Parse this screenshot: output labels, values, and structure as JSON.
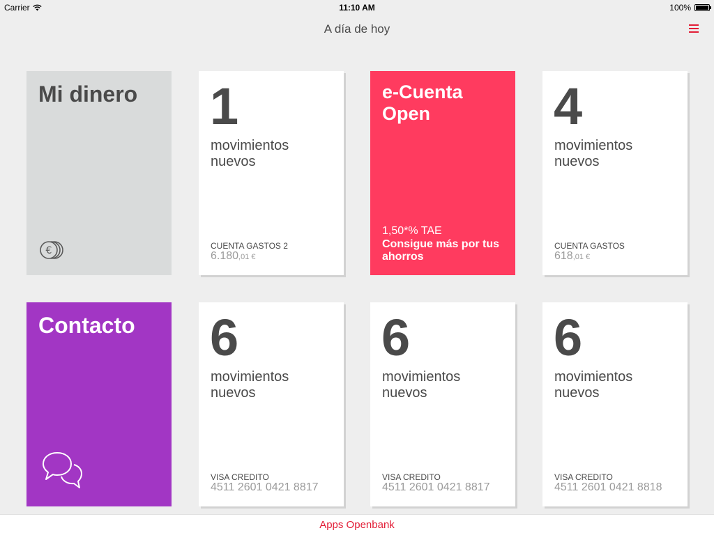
{
  "status_bar": {
    "carrier": "Carrier",
    "time": "11:10 AM",
    "battery": "100%",
    "battery_level": 1.0
  },
  "nav": {
    "title": "A día de hoy",
    "menu_icon": "hamburger-menu-icon"
  },
  "tiles": {
    "mi_dinero": {
      "title": "Mi dinero",
      "icon": "euro-coins-icon"
    },
    "account_1": {
      "count": "1",
      "label": "movimientos nuevos",
      "account_name": "CUENTA GASTOS 2",
      "amount_main": "6.180",
      "amount_decimals": ",01 €"
    },
    "promo": {
      "title": "e-Cuenta Open",
      "tae": "1,50*% TAE",
      "text": "Consigue más por tus ahorros"
    },
    "account_2": {
      "count": "4",
      "label": "movimientos nuevos",
      "account_name": "CUENTA GASTOS",
      "amount_main": "618",
      "amount_decimals": ",01 €"
    },
    "contacto": {
      "title": "Contacto",
      "icon": "chat-bubbles-icon"
    },
    "card_1": {
      "count": "6",
      "label": "movimientos nuevos",
      "card_name": "VISA CREDITO",
      "card_number": "4511 2601 0421 8817"
    },
    "card_2": {
      "count": "6",
      "label": "movimientos nuevos",
      "card_name": "VISA CREDITO",
      "card_number": "4511 2601 0421 8817"
    },
    "card_3": {
      "count": "6",
      "label": "movimientos nuevos",
      "card_name": "VISA CREDITO",
      "card_number": "4511 2601 0421 8818"
    }
  },
  "bottom": {
    "link": "Apps Openbank"
  },
  "colors": {
    "accent_red": "#e21d36",
    "promo_pink": "#ff3b5f",
    "contacto_purple": "#a236c4",
    "mi_dinero_gray": "#d9dbdb",
    "text_dark": "#4a4a4a"
  }
}
